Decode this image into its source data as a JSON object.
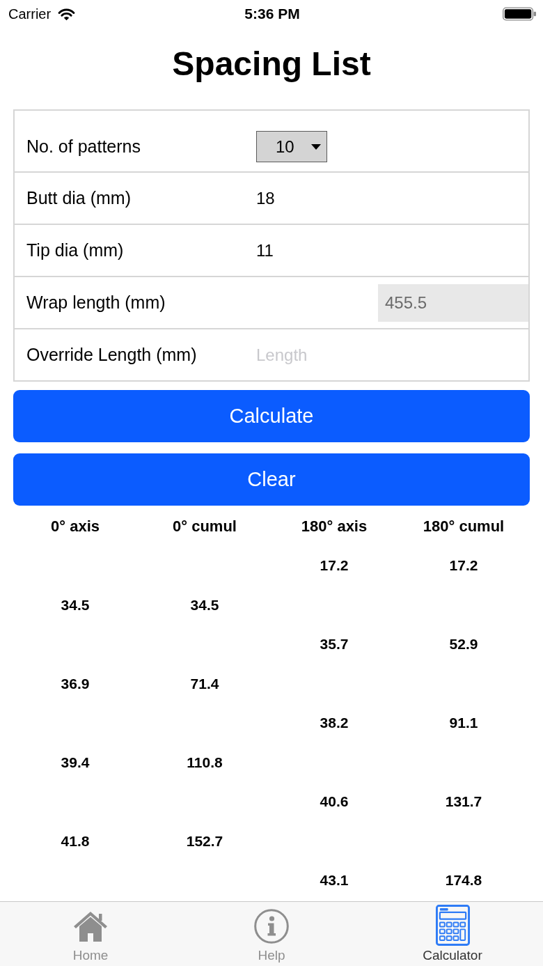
{
  "status_bar": {
    "carrier": "Carrier",
    "time": "5:36 PM"
  },
  "title": "Spacing List",
  "form": [
    {
      "kind": "dropdown",
      "label": "No. of patterns",
      "value": "10"
    },
    {
      "kind": "input",
      "label": "Butt dia (mm)",
      "value": "18",
      "disabled": false
    },
    {
      "kind": "input",
      "label": "Tip dia (mm)",
      "value": "11",
      "disabled": false
    },
    {
      "kind": "input",
      "label": "Wrap length (mm)",
      "value": "455.5",
      "disabled": true
    },
    {
      "kind": "input",
      "label": "Override Length (mm)",
      "placeholder": "Length",
      "disabled": false
    }
  ],
  "buttons": [
    {
      "label": "Calculate"
    },
    {
      "label": "Clear"
    }
  ],
  "table": {
    "columns": [
      "0° axis",
      "0° cumul",
      "180° axis",
      "180° cumul"
    ],
    "rows": [
      {
        "kind": "right",
        "axis": "17.2",
        "cumul": "17.2"
      },
      {
        "kind": "left",
        "axis": "34.5",
        "cumul": "34.5"
      },
      {
        "kind": "right",
        "axis": "35.7",
        "cumul": "52.9"
      },
      {
        "kind": "left",
        "axis": "36.9",
        "cumul": "71.4"
      },
      {
        "kind": "right",
        "axis": "38.2",
        "cumul": "91.1"
      },
      {
        "kind": "left",
        "axis": "39.4",
        "cumul": "110.8"
      },
      {
        "kind": "right",
        "axis": "40.6",
        "cumul": "131.7"
      },
      {
        "kind": "left",
        "axis": "41.8",
        "cumul": "152.7"
      },
      {
        "kind": "right",
        "axis": "43.1",
        "cumul": "174.8"
      }
    ]
  },
  "tabs": [
    {
      "label": "Home",
      "selected": false
    },
    {
      "label": "Help",
      "selected": false
    },
    {
      "label": "Calculator",
      "selected": true
    }
  ]
}
